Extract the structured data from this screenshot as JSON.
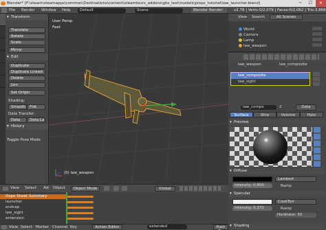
{
  "window": {
    "title": "Blender* [F:\\steam\\steamapps\\common\\Destinations\\content\\steamtours_addons\\gbs_test\\models\\props_tutorial\\law_launcher.blend]",
    "minimize_glyph": "─",
    "maximize_glyph": "☐",
    "close_glyph": "✕"
  },
  "info_header": {
    "menus": [
      "File",
      "Render",
      "Window",
      "Help"
    ],
    "layout": "Default",
    "scene": "Scene",
    "engine": "Blender Render",
    "stats": "v2.78 | Verts:0/2,079 | Faces:0/2,062 | Tris:3,868 | Ob"
  },
  "tool_shelf": {
    "tabs": [
      "Tools",
      "Create",
      "Relations",
      "Animation",
      "Physics",
      "Grease Pencil"
    ],
    "transform": {
      "header": "Transform",
      "buttons": [
        "Translate",
        "Rotate",
        "Scale",
        "Mirror"
      ]
    },
    "edit": {
      "header": "Edit",
      "buttons": [
        "Duplicate",
        "Duplicate Linked",
        "Delete",
        "Join"
      ],
      "origin": "Set Origin"
    },
    "shading": {
      "label": "Shading:",
      "smooth": "Smooth",
      "flat": "Flat"
    },
    "data_transfer": {
      "label": "Data Transfer:",
      "data": "Data",
      "data_layers": "Data La"
    },
    "history": "History",
    "toggle_pose": "Toggle Pose Mode"
  },
  "viewport": {
    "view_label": "User Persp",
    "units": "Feet",
    "object_label": "(0) law_weapon",
    "header": {
      "menus": [
        "View",
        "Select",
        "Add",
        "Object"
      ],
      "mode": "Object Mode",
      "pivot": "Global"
    }
  },
  "outliner": {
    "header_items": [
      "View",
      "Search",
      "All Scenes"
    ],
    "rows": [
      {
        "label": "World",
        "color": "#3d8fd6"
      },
      {
        "label": "Camera",
        "color": "#888888"
      },
      {
        "label": "Lamp",
        "color": "#d6c43d"
      },
      {
        "label": "law_weapon",
        "color": "#e6a23c"
      }
    ]
  },
  "properties": {
    "breadcrumb": [
      "law_weapon",
      "law_composite"
    ],
    "material_slots": [
      {
        "name": "law_composite",
        "selected": true
      },
      {
        "name": "law_sight",
        "selected": false
      }
    ],
    "material_name": "law_compo",
    "material_count": "2",
    "link": "Data",
    "context_tabs": [
      "Surface",
      "Wire",
      "Volume",
      "Halo"
    ],
    "active_context_tab": "Surface",
    "preview_header": "Preview",
    "diffuse": {
      "header": "Diffuse",
      "shader": "Lambert",
      "intensity": "Intensity: 0.800",
      "ramp": "Ramp"
    },
    "specular": {
      "header": "Specular",
      "shader": "CookTorr",
      "intensity": "Intensity: 0.372",
      "ramp": "Ramp",
      "hardness": "Hardness: 50"
    },
    "shading_header": "Shading"
  },
  "dopesheet": {
    "summary": "Dope Sheet Summary",
    "channels": [
      "launcher",
      "endcap",
      "law_sight",
      "extension"
    ],
    "header": {
      "menus": [
        "View",
        "Select",
        "Marker",
        "Channel",
        "Key"
      ],
      "editor": "Action Editor",
      "action": "extended",
      "push_down": "Push Do"
    }
  },
  "colors": {
    "accent": "#5680c2",
    "selection_outline": "#e6d600",
    "keyframe": "#e67e12",
    "viewport_bg": "#393939"
  }
}
